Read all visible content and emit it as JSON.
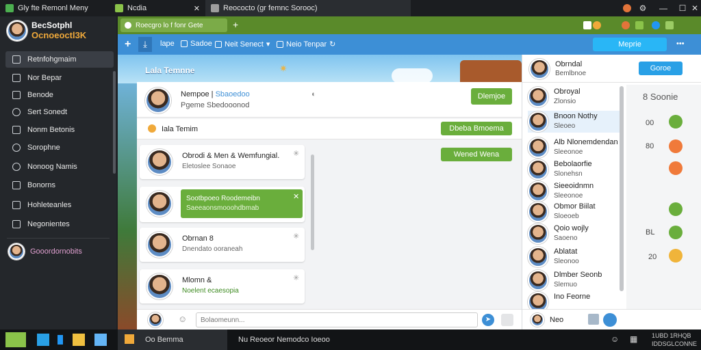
{
  "titlebar": {
    "tab1": "Gly   fte Remonl Meny",
    "tab2": "Ncdia",
    "tab3": "Reococto (gr femnc Sorooc)",
    "close_glyph": "✕"
  },
  "app": {
    "title": "BecSotphl",
    "subtitle": "Ocnoeoctl3K"
  },
  "sidebar": {
    "items": [
      {
        "label": "Retnfohgmaim",
        "icon": "home-icon"
      },
      {
        "label": "Nor Bepar",
        "icon": "grid-icon"
      },
      {
        "label": "Benode",
        "icon": "doc-icon"
      },
      {
        "label": "Sert Sonedt",
        "icon": "chat-icon"
      },
      {
        "label": "Nonm Betonis",
        "icon": "pen-icon"
      },
      {
        "label": "Sorophne",
        "icon": "target-icon"
      },
      {
        "label": "Nonoog Namis",
        "icon": "globe-icon"
      },
      {
        "label": "Bonorns",
        "icon": "tag-icon"
      },
      {
        "label": "Hohleteanles",
        "icon": "list-icon"
      },
      {
        "label": "Negonientes",
        "icon": "folder-icon"
      }
    ],
    "profile_label": "Gooordornobits"
  },
  "browserbar": {
    "tab_label": "Roecgro lo f fonr Gete",
    "plus": "+"
  },
  "toolbar": {
    "item1": "lape",
    "item2": "Sadoe",
    "item3": "Neit  Senect",
    "item4": "Neio  Tenpar",
    "action_button": "Meprie",
    "more": "•••"
  },
  "banner": {
    "title": "Lala Temnne"
  },
  "chat_header": {
    "name": "Nempoe | ",
    "tag": "Sbaoedoo",
    "status": "Pgeme Sbedooonod",
    "button": "Dlemjoe"
  },
  "filter": {
    "label": "Iala Temim",
    "pill1": "Dbeba Bmoema",
    "pill2": "Wened Wena"
  },
  "chats": [
    {
      "name": "Obrodi & Men & Wemfungial.",
      "preview": "Eletoslee  Sonaoe",
      "highlight": false
    },
    {
      "name": "Sootbpoeo Roodemeibn",
      "preview": "Saeeaonsmooohdbmab",
      "highlight": true
    },
    {
      "name": "Obrnan 8",
      "preview": "Dnendato ooraneah",
      "highlight": false
    },
    {
      "name": "Mlomn &",
      "preview": "Noelent ecaesopia",
      "highlight": false
    }
  ],
  "compose": {
    "placeholder": "Bolaomeunn..."
  },
  "rightpanel": {
    "user_name": "Obrndal",
    "user_status": "Bemlbnoe",
    "button": "Goroe",
    "contacts": [
      {
        "name": "Obroyal",
        "status": "Zlonsio"
      },
      {
        "name": "Bnoon Nothy",
        "status": "Sleoeo"
      },
      {
        "name": "Alb Nlonemdendan",
        "status": "Sleeonoe"
      },
      {
        "name": "Bebolaorfie",
        "status": "Slonehsn"
      },
      {
        "name": "Sieeoidnmn",
        "status": "Sleeonoe"
      },
      {
        "name": "Obmor Biilat",
        "status": "Sloeoeb"
      },
      {
        "name": "Qoio wojly",
        "status": "Saoeno"
      },
      {
        "name": "Ablatat",
        "status": "Sleonoo"
      },
      {
        "name": "Dlmber Seonb",
        "status": "Slemuo"
      },
      {
        "name": "Ino Feorne",
        "status": ""
      }
    ],
    "side_header": "8 Soonie",
    "side_values": [
      "00",
      "80",
      "BL",
      "20"
    ],
    "bottom_label": "Neo"
  },
  "taskbar": {
    "app1": "Oo  Bemma",
    "app2": "Nu  Reoeor Nemodco Ioeoo",
    "time": "1UBD 1RHQB",
    "date": "IDDSGLCONNE"
  },
  "colors": {
    "accent_blue": "#3d8fd6",
    "accent_green": "#6aae3c",
    "sidebar_bg": "#24272b"
  }
}
